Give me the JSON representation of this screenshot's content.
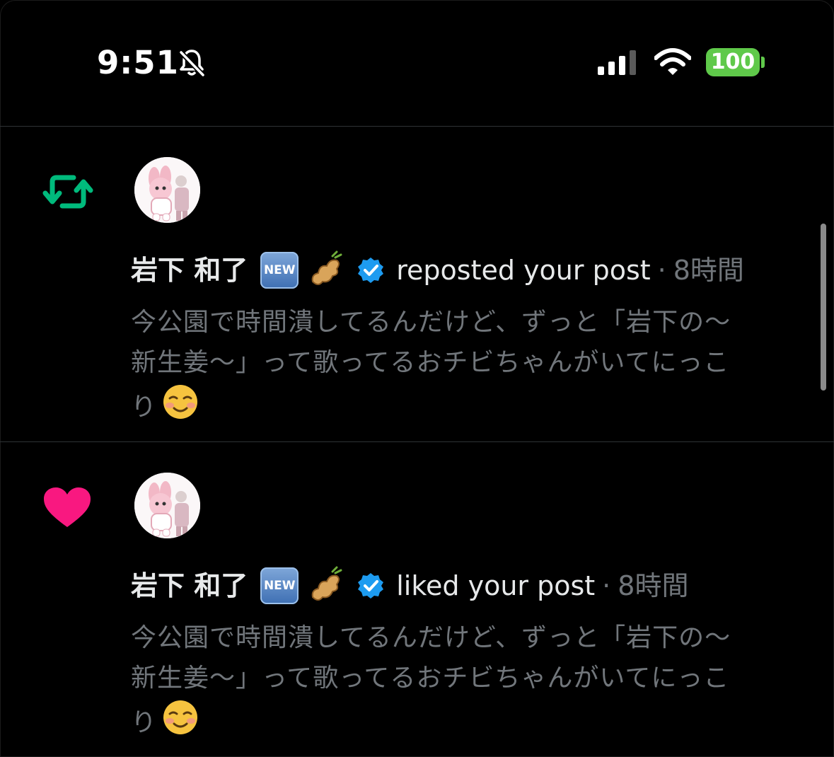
{
  "status_bar": {
    "time": "9:51",
    "battery": "100",
    "battery_color": "#5fc94a"
  },
  "notifications": [
    {
      "type_icon": "repost-icon",
      "type_color": "#00ba7c",
      "name": "岩下 和了",
      "new_badge": "NEW",
      "action": "reposted your post",
      "separator": "·",
      "time_ago": "8時間",
      "text_lines": [
        "今公園で時間潰してるんだけど、ずっと「岩下の〜",
        "新生姜〜」って歌ってるおチビちゃんがいてにっこ",
        "り"
      ]
    },
    {
      "type_icon": "heart-icon",
      "type_color": "#f91880",
      "name": "岩下 和了",
      "new_badge": "NEW",
      "action": "liked your post",
      "separator": "·",
      "time_ago": "8時間",
      "text_lines": [
        "今公園で時間潰してるんだけど、ずっと「岩下の〜",
        "新生姜〜」って歌ってるおチビちゃんがいてにっこ",
        "り"
      ]
    }
  ]
}
